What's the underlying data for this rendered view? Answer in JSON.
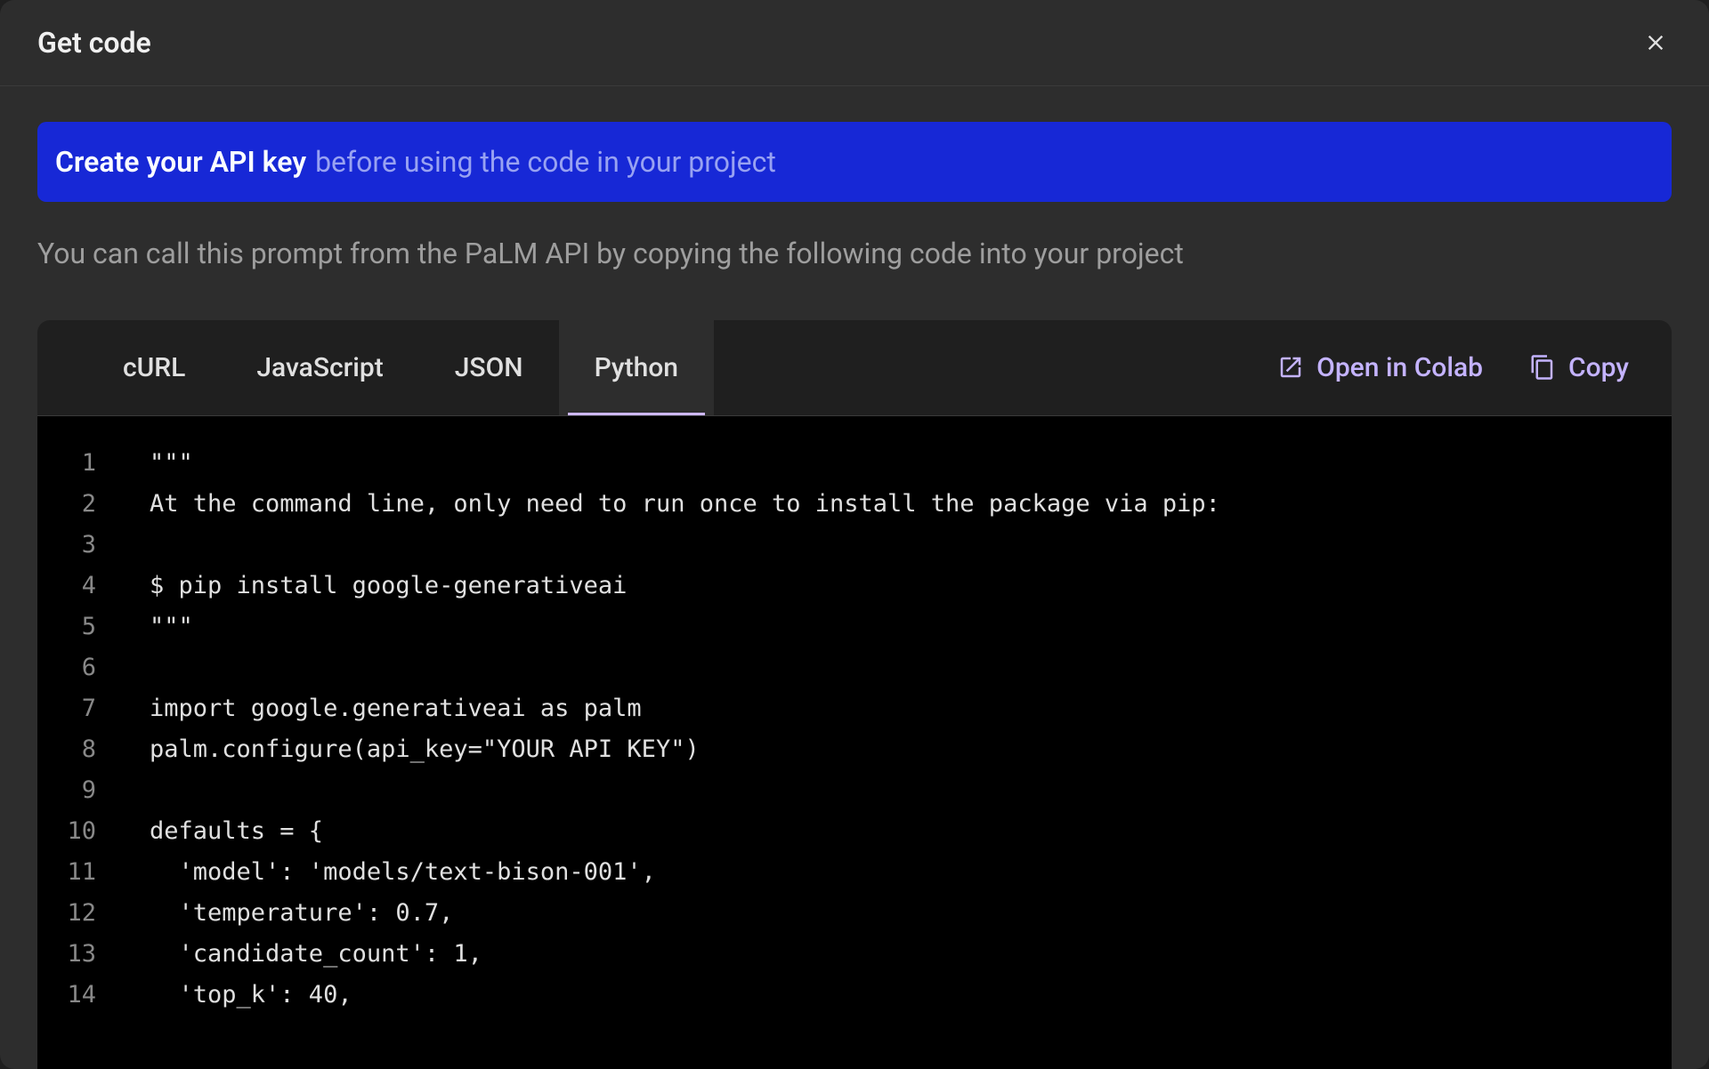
{
  "modal": {
    "title": "Get code",
    "banner_link": "Create your API key",
    "banner_text": "before using the code in your project",
    "description": "You can call this prompt from the PaLM API by copying the following code into your project"
  },
  "tabs": [
    {
      "label": "cURL",
      "active": false
    },
    {
      "label": "JavaScript",
      "active": false
    },
    {
      "label": "JSON",
      "active": false
    },
    {
      "label": "Python",
      "active": true
    }
  ],
  "actions": {
    "open_colab": "Open in Colab",
    "copy": "Copy"
  },
  "code": {
    "lines": [
      "\"\"\"",
      "At the command line, only need to run once to install the package via pip:",
      "",
      "$ pip install google-generativeai",
      "\"\"\"",
      "",
      "import google.generativeai as palm",
      "palm.configure(api_key=\"YOUR API KEY\")",
      "",
      "defaults = {",
      "  'model': 'models/text-bison-001',",
      "  'temperature': 0.7,",
      "  'candidate_count': 1,",
      "  'top_k': 40,"
    ]
  }
}
